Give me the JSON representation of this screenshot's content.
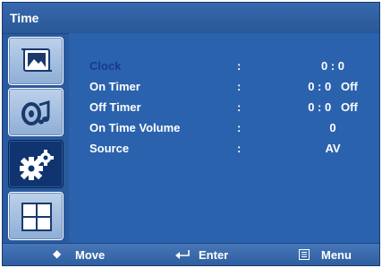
{
  "title": "Time",
  "sidebar": {
    "items": [
      {
        "name": "picture",
        "icon": "picture-icon"
      },
      {
        "name": "sound",
        "icon": "sound-icon"
      },
      {
        "name": "setup",
        "icon": "gears-icon",
        "active": true
      },
      {
        "name": "layout",
        "icon": "grid-icon"
      }
    ]
  },
  "menu": {
    "separator": ":",
    "rows": [
      {
        "label": "Clock",
        "value": "0 : 0",
        "selected": true
      },
      {
        "label": "On Timer",
        "value": "0 : 0   Off"
      },
      {
        "label": "Off Timer",
        "value": "0 : 0   Off"
      },
      {
        "label": "On Time Volume",
        "value": "0"
      },
      {
        "label": "Source",
        "value": "AV"
      }
    ]
  },
  "footer": {
    "move_label": "Move",
    "enter_label": "Enter",
    "menu_label": "Menu"
  },
  "colors": {
    "panel": "#2b62ad",
    "selected_label": "#1a3a8e",
    "active_tab": "#0f3470"
  }
}
